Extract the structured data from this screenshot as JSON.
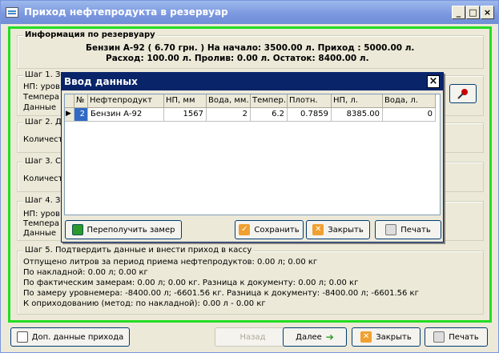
{
  "window": {
    "title": "Приход нефтепродукта в резервуар",
    "min": "_",
    "max": "□",
    "close": "×"
  },
  "info": {
    "legend": "Информация по резервуару",
    "line1": "Бензин А-92 ( 6.70 грн. ) На начало:  3500.00 л. Приход :  5000.00 л.",
    "line2": "Расход:  100.00 л. Пролив:     0.00 л. Остаток:  8400.00 л."
  },
  "steps": {
    "s1": {
      "legend": "Шаг 1. З",
      "l1": "НП: уров",
      "l2": "Темпера",
      "l3": "Данные"
    },
    "s2": {
      "legend": "Шаг 2. Д",
      "l1": "Количест"
    },
    "s3": {
      "legend": "Шаг 3. С",
      "l1": "Количест"
    },
    "s4": {
      "legend": "Шаг 4. З",
      "l1": "НП: уров",
      "l2": "Темпера",
      "l3": "Данные"
    },
    "s5": {
      "legend": "Шаг 5. Подтвердить данные и внести приход в кассу",
      "lines": [
        "Отпущено литров за период приема нефтепродуктов: 0.00 л; 0.00 кг",
        "По накладной: 0.00 л; 0.00 кг",
        "По фактическим замерам: 0.00 л; 0.00 кг. Разница к документу: 0.00 л; 0.00 кг",
        "По замеру уровнемера: -8400.00 л; -6601.56 кг. Разница к документу: -8400.00 л; -6601.56 кг",
        "К оприходованию (метод: по накладной): 0.00 л - 0.00 кг"
      ]
    }
  },
  "dialog": {
    "title": "Ввод данных",
    "close": "×",
    "columns": [
      "№",
      "Нефтепродукт",
      "НП, мм",
      "Вода, мм.",
      "Темпер.",
      "Плотн.",
      "НП, л.",
      "Вода, л."
    ],
    "rows": [
      {
        "n": "2",
        "product": "Бензин А-92",
        "np_mm": "1567",
        "water_mm": "2",
        "temp": "6.2",
        "density": "0.7859",
        "np_l": "8385.00",
        "water_l": "0"
      }
    ],
    "buttons": {
      "remeasure": "Переполучить замер",
      "save": "Сохранить",
      "close": "Закрыть",
      "print": "Печать"
    }
  },
  "footer": {
    "extra": "Доп. данные прихода",
    "back": "Назад",
    "next": "Далее",
    "close": "Закрыть",
    "print": "Печать"
  },
  "colors": {
    "title_bar": "#7a96df",
    "dialog_title": "#0a246a",
    "frame": "#22dd22",
    "pin": "#cc0000"
  }
}
